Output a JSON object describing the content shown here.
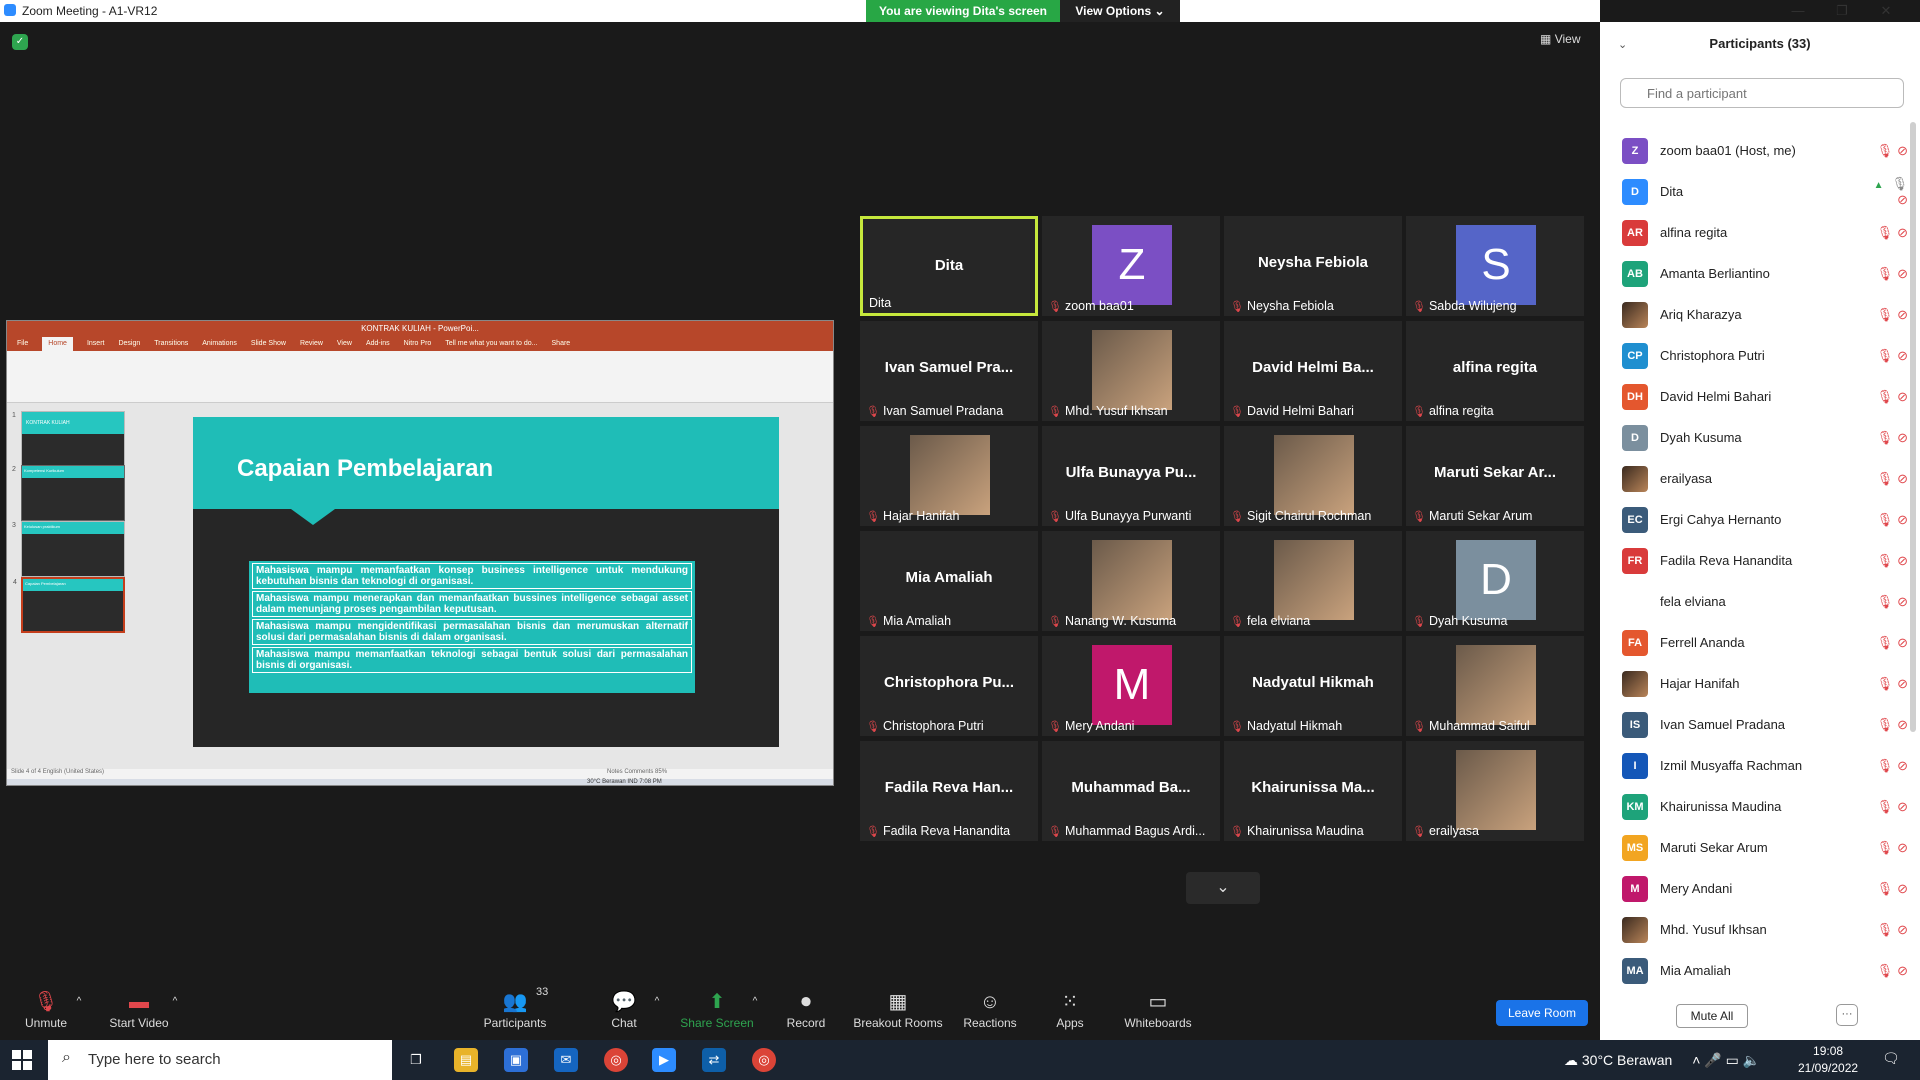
{
  "window": {
    "title": "Zoom Meeting - A1-VR12",
    "viewing_banner": "You are viewing Dita's screen",
    "view_options": "View Options",
    "view_label": "View"
  },
  "share": {
    "app_title": "KONTRAK KULIAH - PowerPoi...",
    "tabs": [
      "File",
      "Home",
      "Insert",
      "Design",
      "Transitions",
      "Animations",
      "Slide Show",
      "Review",
      "View",
      "Add-ins",
      "Nitro Pro"
    ],
    "tell_me": "Tell me what you want to do...",
    "share_label": "Share",
    "thumb_titles": [
      "KONTRAK KULIAH",
      "Kompetensi Kurikulum",
      "Kelulusan praktikum",
      "Capaian Pembelajaran"
    ],
    "slide_title": "Capaian Pembelajaran",
    "items": [
      "Mahasiswa mampu memanfaatkan konsep business intelligence untuk mendukung kebutuhan bisnis dan teknologi di organisasi.",
      "Mahasiswa mampu menerapkan dan memanfaatkan bussines intelligence sebagai asset dalam menunjang proses pengambilan keputusan.",
      "Mahasiswa mampu mengidentifikasi permasalahan bisnis dan merumuskan alternatif solusi dari permasalahan bisnis di dalam organisasi.",
      "Mahasiswa mampu memanfaatkan teknologi sebagai bentuk solusi dari permasalahan bisnis di organisasi."
    ],
    "status_left": "Slide 4 of 4    English (United States)",
    "status_right": "Notes   Comments      85%",
    "taskbar_text": "30°C Berawan    IND   7:08 PM"
  },
  "tiles": [
    {
      "big": "Dita",
      "avatar": "",
      "label": "Dita",
      "active": true,
      "muted": false,
      "color": ""
    },
    {
      "big": "",
      "avatar": "Z",
      "label": "zoom baa01",
      "active": false,
      "muted": true,
      "color": "#7b4fc4"
    },
    {
      "big": "Neysha Febiola",
      "avatar": "",
      "label": "Neysha Febiola",
      "active": false,
      "muted": true,
      "color": ""
    },
    {
      "big": "",
      "avatar": "S",
      "label": "Sabda Wilujeng",
      "active": false,
      "muted": true,
      "color": "#5565c8"
    },
    {
      "big": "Ivan Samuel Pra...",
      "avatar": "",
      "label": "Ivan Samuel Pradana",
      "active": false,
      "muted": true,
      "color": ""
    },
    {
      "big": "",
      "avatar": "img",
      "label": "Mhd. Yusuf Ikhsan",
      "active": false,
      "muted": true,
      "color": ""
    },
    {
      "big": "David Helmi Ba...",
      "avatar": "",
      "label": "David Helmi Bahari",
      "active": false,
      "muted": true,
      "color": ""
    },
    {
      "big": "alfina regita",
      "avatar": "",
      "label": "alfina regita",
      "active": false,
      "muted": true,
      "color": ""
    },
    {
      "big": "",
      "avatar": "img",
      "label": "Hajar Hanifah",
      "active": false,
      "muted": true,
      "color": ""
    },
    {
      "big": "Ulfa Bunayya Pu...",
      "avatar": "",
      "label": "Ulfa Bunayya Purwanti",
      "active": false,
      "muted": true,
      "color": ""
    },
    {
      "big": "",
      "avatar": "img",
      "label": "Sigit Chairul Rochman",
      "active": false,
      "muted": true,
      "color": ""
    },
    {
      "big": "Maruti Sekar Ar...",
      "avatar": "",
      "label": "Maruti Sekar Arum",
      "active": false,
      "muted": true,
      "color": ""
    },
    {
      "big": "Mia Amaliah",
      "avatar": "",
      "label": "Mia Amaliah",
      "active": false,
      "muted": true,
      "color": ""
    },
    {
      "big": "",
      "avatar": "img",
      "label": "Nanang W. Kusuma",
      "active": false,
      "muted": true,
      "color": ""
    },
    {
      "big": "",
      "avatar": "img",
      "label": "fela elviana",
      "active": false,
      "muted": true,
      "color": ""
    },
    {
      "big": "",
      "avatar": "D",
      "label": "Dyah Kusuma",
      "active": false,
      "muted": true,
      "color": "#7b8f9e"
    },
    {
      "big": "Christophora Pu...",
      "avatar": "",
      "label": "Christophora Putri",
      "active": false,
      "muted": true,
      "color": ""
    },
    {
      "big": "",
      "avatar": "M",
      "label": "Mery Andani",
      "active": false,
      "muted": true,
      "color": "#c0186b"
    },
    {
      "big": "Nadyatul Hikmah",
      "avatar": "",
      "label": "Nadyatul Hikmah",
      "active": false,
      "muted": true,
      "color": ""
    },
    {
      "big": "",
      "avatar": "img",
      "label": "Muhammad Saiful",
      "active": false,
      "muted": true,
      "color": ""
    },
    {
      "big": "Fadila Reva Han...",
      "avatar": "",
      "label": "Fadila Reva Hanandita",
      "active": false,
      "muted": true,
      "color": ""
    },
    {
      "big": "Muhammad Ba...",
      "avatar": "",
      "label": "Muhammad Bagus Ardi...",
      "active": false,
      "muted": true,
      "color": ""
    },
    {
      "big": "Khairunissa Ma...",
      "avatar": "",
      "label": "Khairunissa Maudina",
      "active": false,
      "muted": true,
      "color": ""
    },
    {
      "big": "",
      "avatar": "img",
      "label": "erailyasa",
      "active": false,
      "muted": true,
      "color": ""
    }
  ],
  "toolbar": {
    "unmute": "Unmute",
    "start_video": "Start Video",
    "participants": "Participants",
    "participants_count": "33",
    "chat": "Chat",
    "share_screen": "Share Screen",
    "record": "Record",
    "breakout": "Breakout Rooms",
    "reactions": "Reactions",
    "apps": "Apps",
    "whiteboards": "Whiteboards",
    "leave": "Leave Room"
  },
  "panel": {
    "title": "Participants (33)",
    "search_placeholder": "Find a participant",
    "mute_all": "Mute All",
    "participants": [
      {
        "initials": "Z",
        "name": "zoom baa01 (Host, me)",
        "color": "#7b4fc4",
        "sharing": false
      },
      {
        "initials": "D",
        "name": "Dita",
        "color": "#2d8cff",
        "sharing": true
      },
      {
        "initials": "AR",
        "name": "alfina regita",
        "color": "#d93b3b",
        "sharing": false
      },
      {
        "initials": "AB",
        "name": "Amanta Berliantino",
        "color": "#1ea37a",
        "sharing": false
      },
      {
        "initials": "img",
        "name": "Ariq Kharazya",
        "color": "",
        "sharing": false
      },
      {
        "initials": "CP",
        "name": "Christophora Putri",
        "color": "#1f8fd0",
        "sharing": false
      },
      {
        "initials": "DH",
        "name": "David Helmi Bahari",
        "color": "#e4572e",
        "sharing": false
      },
      {
        "initials": "D",
        "name": "Dyah Kusuma",
        "color": "#7b8f9e",
        "sharing": false
      },
      {
        "initials": "img",
        "name": "erailyasa",
        "color": "",
        "sharing": false
      },
      {
        "initials": "EC",
        "name": "Ergi Cahya Hernanto",
        "color": "#3b5b7a",
        "sharing": false
      },
      {
        "initials": "FR",
        "name": "Fadila Reva Hanandita",
        "color": "#d93b3b",
        "sharing": false
      },
      {
        "initials": "",
        "name": "fela elviana",
        "color": "#ffffff",
        "sharing": false
      },
      {
        "initials": "FA",
        "name": "Ferrell Ananda",
        "color": "#e4572e",
        "sharing": false
      },
      {
        "initials": "img",
        "name": "Hajar Hanifah",
        "color": "",
        "sharing": false
      },
      {
        "initials": "IS",
        "name": "Ivan Samuel Pradana",
        "color": "#3b5b7a",
        "sharing": false
      },
      {
        "initials": "I",
        "name": "Izmil Musyaffa Rachman",
        "color": "#1457b8",
        "sharing": false
      },
      {
        "initials": "KM",
        "name": "Khairunissa Maudina",
        "color": "#1ea37a",
        "sharing": false
      },
      {
        "initials": "MS",
        "name": "Maruti Sekar Arum",
        "color": "#f2a521",
        "sharing": false
      },
      {
        "initials": "M",
        "name": "Mery Andani",
        "color": "#c0186b",
        "sharing": false
      },
      {
        "initials": "img",
        "name": "Mhd. Yusuf Ikhsan",
        "color": "",
        "sharing": false
      },
      {
        "initials": "MA",
        "name": "Mia Amaliah",
        "color": "#3b5b7a",
        "sharing": false
      }
    ]
  },
  "taskbar": {
    "search_placeholder": "Type here to search",
    "weather": "30°C  Berawan",
    "time": "19:08",
    "date": "21/09/2022"
  }
}
